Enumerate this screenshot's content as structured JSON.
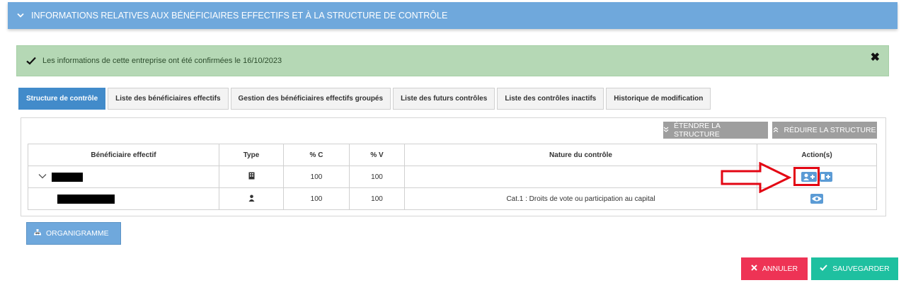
{
  "section": {
    "title": "INFORMATIONS RELATIVES AUX BÉNÉFICIAIRES EFFECTIFS ET À LA STRUCTURE DE CONTRÔLE",
    "icon": "chevron-down-icon"
  },
  "alert": {
    "message": "Les informations de cette entreprise ont été confirmées le 16/10/2023",
    "close": "✖",
    "color": "#b5d8b5"
  },
  "tabs": [
    {
      "label": "Structure de contrôle",
      "active": true
    },
    {
      "label": "Liste des bénéficiaires effectifs",
      "active": false
    },
    {
      "label": "Gestion des bénéficiaires effectifs groupés",
      "active": false
    },
    {
      "label": "Liste des futurs contrôles",
      "active": false
    },
    {
      "label": "Liste des contrôles inactifs",
      "active": false
    },
    {
      "label": "Historique de modification",
      "active": false
    }
  ],
  "toolbar": {
    "extend_label": "ÉTENDRE LA STRUCTURE",
    "reduce_label": "RÉDUIRE LA STRUCTURE"
  },
  "table": {
    "headers": [
      "Bénéficiaire effectif",
      "Type",
      "% C",
      "% V",
      "Nature du contrôle",
      "Action(s)"
    ],
    "rows": [
      {
        "beneficiary": "[redacted]",
        "type_icon": "building-icon",
        "pct_c": "100",
        "pct_v": "100",
        "nature": "",
        "actions": [
          "add-person-icon",
          "add-icon"
        ]
      },
      {
        "beneficiary": "[redacted]",
        "type_icon": "person-icon",
        "pct_c": "100",
        "pct_v": "100",
        "nature": "Cat.1 : Droits de vote ou participation au capital",
        "actions": [
          "eye-icon"
        ]
      }
    ]
  },
  "buttons": {
    "org_label": "ORGANIGRAMME",
    "cancel_label": "ANNULER",
    "save_label": "SAUVEGARDER"
  },
  "colors": {
    "header": "#6fa8dc",
    "tab_active": "#428bca",
    "cancel": "#ee3355",
    "save": "#1ec0a0",
    "annotation": "#e30613"
  }
}
